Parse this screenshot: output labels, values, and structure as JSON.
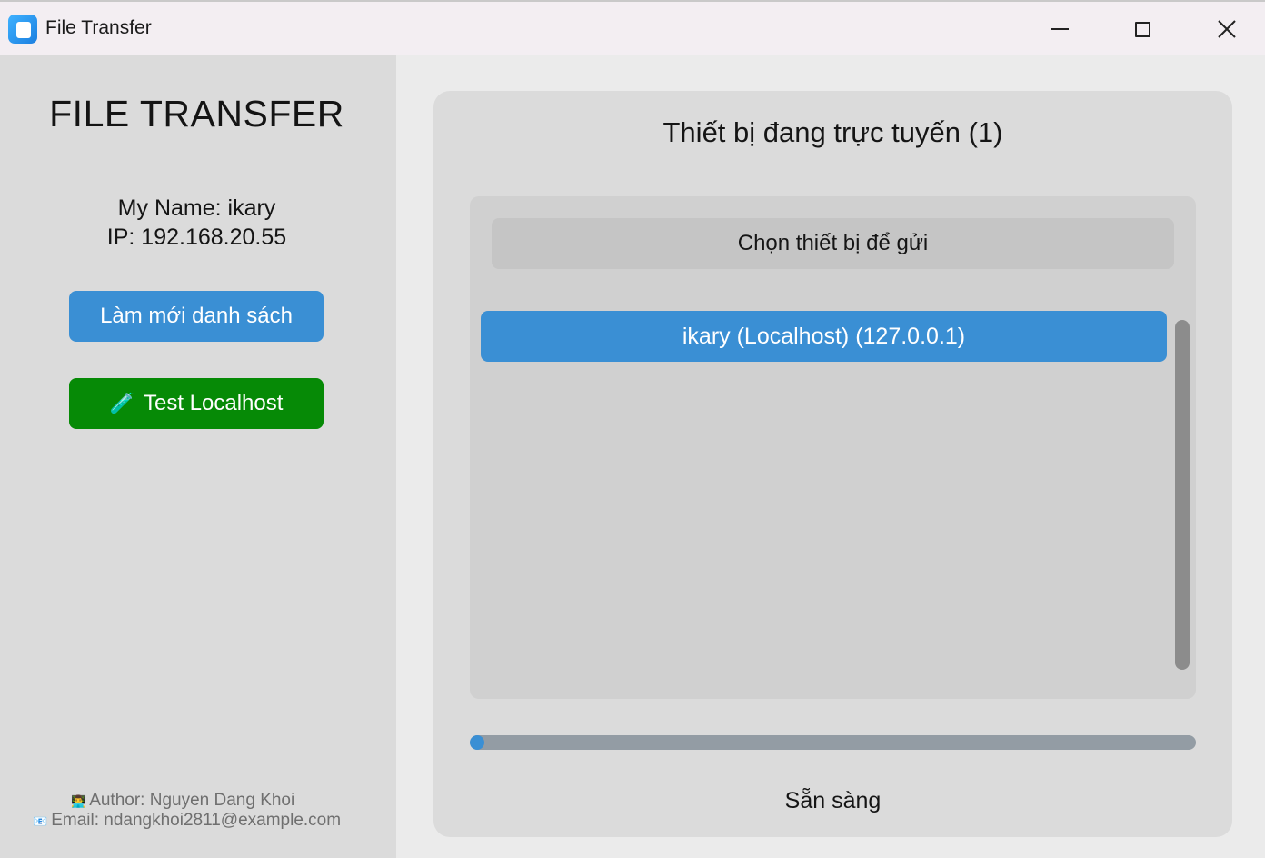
{
  "window": {
    "title": "File Transfer",
    "icon": "app-icon"
  },
  "sidebar": {
    "heading": "FILE TRANSFER",
    "my_name": "My Name: ikary",
    "ip": "IP: 192.168.20.55",
    "refresh_button": "Làm mới danh sách",
    "test_button": "Test Localhost",
    "test_button_icon": "🧪",
    "footer": {
      "author_icons": "👨‍💻",
      "author": "Author: Nguyen Dang Khoi",
      "email_icon": "📧",
      "email": "Email: ndangkhoi2811@example.com"
    }
  },
  "main": {
    "title": "Thiết bị đang trực tuyến (1)",
    "list_header": "Chọn thiết bị để gửi",
    "devices": [
      {
        "label": "ikary (Localhost) (127.0.0.1)",
        "selected": true
      }
    ],
    "progress": 0.0,
    "status": "Sẵn sàng"
  },
  "colors": {
    "accent": "#3a8fd4",
    "success": "#068a06",
    "sidebar_bg": "#dbdbdb",
    "window_bg": "#ebebeb"
  }
}
